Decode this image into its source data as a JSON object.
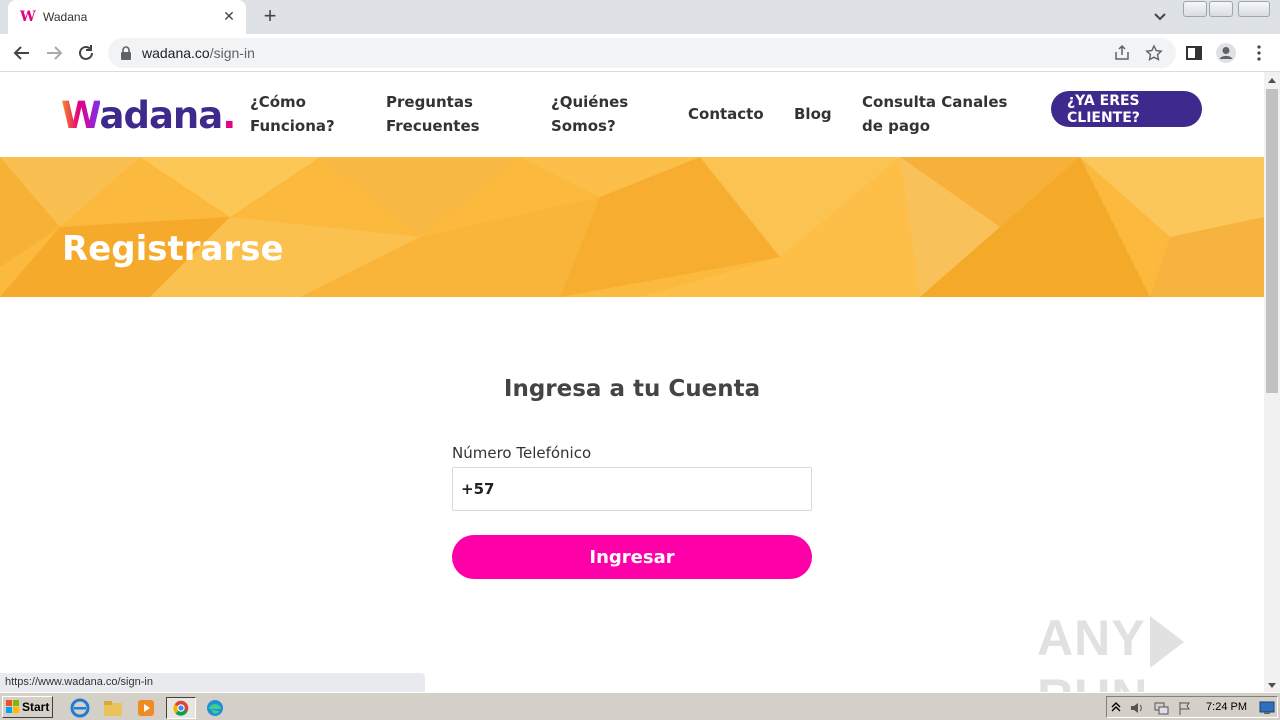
{
  "browser": {
    "tab_title": "Wadana",
    "tab_favicon_letter": "W",
    "url_host": "wadana.co",
    "url_path": "/sign-in",
    "status_url": "https://www.wadana.co/sign-in"
  },
  "site": {
    "logo": {
      "first": "W",
      "rest": "adana",
      "dot": "."
    },
    "nav": [
      {
        "line1": "¿Cómo",
        "line2": "Funciona?"
      },
      {
        "line1": "Preguntas",
        "line2": "Frecuentes"
      },
      {
        "line1": "¿Quiénes",
        "line2": "Somos?"
      },
      {
        "line1": "Contacto",
        "line2": ""
      },
      {
        "line1": "Blog",
        "line2": ""
      },
      {
        "line1": "Consulta Canales",
        "line2": "de pago"
      }
    ],
    "cta": {
      "line1": "¿YA ERES",
      "line2": "CLIENTE?"
    },
    "hero_title": "Registrarse",
    "colors": {
      "brand_purple": "#3d2a8c",
      "brand_pink": "#ff00a8",
      "hero_yellow": "#fbb93d"
    }
  },
  "login": {
    "title": "Ingresa a tu Cuenta",
    "phone_label": "Número Telefónico",
    "phone_value": "+57",
    "submit_label": "Ingresar"
  },
  "watermark": {
    "left": "ANY",
    "right": "RUN"
  },
  "taskbar": {
    "start_label": "Start",
    "clock": "7:24 PM",
    "apps": [
      "ie-icon",
      "explorer-icon",
      "media-player-icon",
      "chrome-icon",
      "edge-icon"
    ]
  }
}
